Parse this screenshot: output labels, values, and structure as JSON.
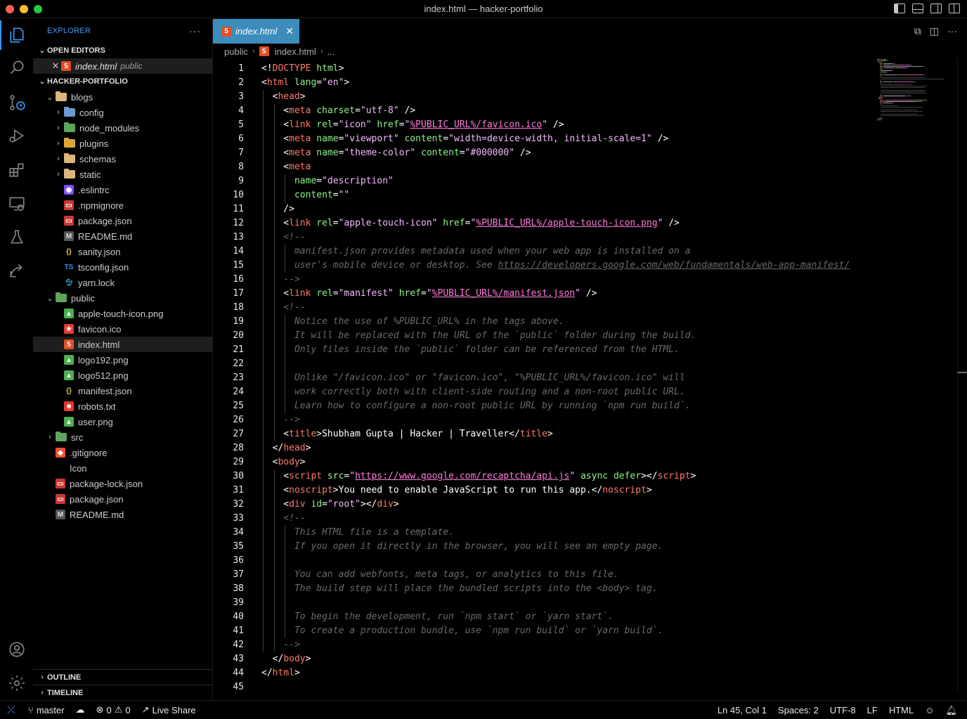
{
  "window": {
    "title": "index.html — hacker-portfolio"
  },
  "sidebar": {
    "title": "EXPLORER",
    "more": "···",
    "open_editors": {
      "label": "OPEN EDITORS",
      "items": [
        {
          "name": "index.html",
          "desc": "public"
        }
      ]
    },
    "project": {
      "label": "HACKER-PORTFOLIO",
      "tree": [
        {
          "name": "blogs",
          "kind": "folder-open",
          "depth": 1
        },
        {
          "name": "config",
          "kind": "folder",
          "depth": 2,
          "color": "blue"
        },
        {
          "name": "node_modules",
          "kind": "folder",
          "depth": 2,
          "color": "green"
        },
        {
          "name": "plugins",
          "kind": "folder",
          "depth": 2,
          "color": "orange"
        },
        {
          "name": "schemas",
          "kind": "folder",
          "depth": 2
        },
        {
          "name": "static",
          "kind": "folder",
          "depth": 2
        },
        {
          "name": ".eslintrc",
          "kind": "eslint",
          "depth": 2
        },
        {
          "name": ".npmignore",
          "kind": "npm",
          "depth": 2
        },
        {
          "name": "package.json",
          "kind": "npm",
          "depth": 2
        },
        {
          "name": "README.md",
          "kind": "md",
          "depth": 2
        },
        {
          "name": "sanity.json",
          "kind": "json",
          "depth": 2
        },
        {
          "name": "tsconfig.json",
          "kind": "ts",
          "depth": 2
        },
        {
          "name": "yarn.lock",
          "kind": "yarn",
          "depth": 2
        },
        {
          "name": "public",
          "kind": "folder-open-green",
          "depth": 1
        },
        {
          "name": "apple-touch-icon.png",
          "kind": "image",
          "depth": 2
        },
        {
          "name": "favicon.ico",
          "kind": "favicon",
          "depth": 2
        },
        {
          "name": "index.html",
          "kind": "html",
          "depth": 2,
          "selected": true
        },
        {
          "name": "logo192.png",
          "kind": "image",
          "depth": 2
        },
        {
          "name": "logo512.png",
          "kind": "image",
          "depth": 2
        },
        {
          "name": "manifest.json",
          "kind": "json",
          "depth": 2
        },
        {
          "name": "robots.txt",
          "kind": "robot",
          "depth": 2
        },
        {
          "name": "user.png",
          "kind": "image",
          "depth": 2
        },
        {
          "name": "src",
          "kind": "folder-green",
          "depth": 1
        },
        {
          "name": ".gitignore",
          "kind": "git",
          "depth": 1
        },
        {
          "name": "Icon",
          "kind": "file",
          "depth": 1
        },
        {
          "name": "package-lock.json",
          "kind": "npm",
          "depth": 1
        },
        {
          "name": "package.json",
          "kind": "npm",
          "depth": 1
        },
        {
          "name": "README.md",
          "kind": "md",
          "depth": 1
        }
      ]
    },
    "outline_label": "OUTLINE",
    "timeline_label": "TIMELINE"
  },
  "editor": {
    "tab_label": "index.html",
    "breadcrumb": [
      "public",
      "index.html",
      "..."
    ]
  },
  "code_lines": [
    [
      [
        "<!",
        "p"
      ],
      [
        "DOCTYPE",
        "tag"
      ],
      [
        " html",
        "attr"
      ],
      [
        ">",
        "p"
      ]
    ],
    [
      [
        "<",
        "p"
      ],
      [
        "html",
        "tag"
      ],
      [
        " lang",
        "attr"
      ],
      [
        "=",
        "p"
      ],
      [
        "\"en\"",
        "str"
      ],
      [
        ">",
        "p"
      ]
    ],
    [
      [
        "  <",
        "p"
      ],
      [
        "head",
        "tag"
      ],
      [
        ">",
        "p"
      ]
    ],
    [
      [
        "    <",
        "p"
      ],
      [
        "meta",
        "tag"
      ],
      [
        " charset",
        "attr"
      ],
      [
        "=",
        "p"
      ],
      [
        "\"utf-8\"",
        "str"
      ],
      [
        " />",
        "p"
      ]
    ],
    [
      [
        "    <",
        "p"
      ],
      [
        "link",
        "tag"
      ],
      [
        " rel",
        "attr"
      ],
      [
        "=",
        "p"
      ],
      [
        "\"icon\"",
        "str"
      ],
      [
        " href",
        "attr"
      ],
      [
        "=",
        "p"
      ],
      [
        "\"",
        "str"
      ],
      [
        "%PUBLIC_URL%/favicon.ico",
        "link"
      ],
      [
        "\"",
        "str"
      ],
      [
        " />",
        "p"
      ]
    ],
    [
      [
        "    <",
        "p"
      ],
      [
        "meta",
        "tag"
      ],
      [
        " name",
        "attr"
      ],
      [
        "=",
        "p"
      ],
      [
        "\"viewport\"",
        "str"
      ],
      [
        " content",
        "attr"
      ],
      [
        "=",
        "p"
      ],
      [
        "\"width=device-width, initial-scale=1\"",
        "str"
      ],
      [
        " />",
        "p"
      ]
    ],
    [
      [
        "    <",
        "p"
      ],
      [
        "meta",
        "tag"
      ],
      [
        " name",
        "attr"
      ],
      [
        "=",
        "p"
      ],
      [
        "\"theme-color\"",
        "str"
      ],
      [
        " content",
        "attr"
      ],
      [
        "=",
        "p"
      ],
      [
        "\"#000000\"",
        "str"
      ],
      [
        " />",
        "p"
      ]
    ],
    [
      [
        "    <",
        "p"
      ],
      [
        "meta",
        "tag"
      ]
    ],
    [
      [
        "      name",
        "attr"
      ],
      [
        "=",
        "p"
      ],
      [
        "\"description\"",
        "str"
      ]
    ],
    [
      [
        "      content",
        "attr"
      ],
      [
        "=",
        "p"
      ],
      [
        "\"\"",
        "str"
      ]
    ],
    [
      [
        "    />",
        "p"
      ]
    ],
    [
      [
        "    <",
        "p"
      ],
      [
        "link",
        "tag"
      ],
      [
        " rel",
        "attr"
      ],
      [
        "=",
        "p"
      ],
      [
        "\"apple-touch-icon\"",
        "str"
      ],
      [
        " href",
        "attr"
      ],
      [
        "=",
        "p"
      ],
      [
        "\"",
        "str"
      ],
      [
        "%PUBLIC_URL%/apple-touch-icon.png",
        "link"
      ],
      [
        "\"",
        "str"
      ],
      [
        " />",
        "p"
      ]
    ],
    [
      [
        "    <!--",
        "com"
      ]
    ],
    [
      [
        "      manifest.json provides metadata used when your web app is installed on a",
        "com"
      ]
    ],
    [
      [
        "      user's mobile device or desktop. See ",
        "com"
      ],
      [
        "https://developers.google.com/web/fundamentals/web-app-manifest/",
        "comlink"
      ]
    ],
    [
      [
        "    -->",
        "com"
      ]
    ],
    [
      [
        "    <",
        "p"
      ],
      [
        "link",
        "tag"
      ],
      [
        " rel",
        "attr"
      ],
      [
        "=",
        "p"
      ],
      [
        "\"manifest\"",
        "str"
      ],
      [
        " href",
        "attr"
      ],
      [
        "=",
        "p"
      ],
      [
        "\"",
        "str"
      ],
      [
        "%PUBLIC_URL%/manifest.json",
        "link"
      ],
      [
        "\"",
        "str"
      ],
      [
        " />",
        "p"
      ]
    ],
    [
      [
        "    <!--",
        "com"
      ]
    ],
    [
      [
        "      Notice the use of %PUBLIC_URL% in the tags above.",
        "com"
      ]
    ],
    [
      [
        "      It will be replaced with the URL of the `public` folder during the build.",
        "com"
      ]
    ],
    [
      [
        "      Only files inside the `public` folder can be referenced from the HTML.",
        "com"
      ]
    ],
    [],
    [
      [
        "      Unlike \"/favicon.ico\" or \"favicon.ico\", \"%PUBLIC_URL%/favicon.ico\" will",
        "com"
      ]
    ],
    [
      [
        "      work correctly both with client-side routing and a non-root public URL.",
        "com"
      ]
    ],
    [
      [
        "      Learn how to configure a non-root public URL by running `npm run build`.",
        "com"
      ]
    ],
    [
      [
        "    -->",
        "com"
      ]
    ],
    [
      [
        "    <",
        "p"
      ],
      [
        "title",
        "tag"
      ],
      [
        ">",
        "p"
      ],
      [
        "Shubham Gupta | Hacker | Traveller",
        "txt"
      ],
      [
        "</",
        "p"
      ],
      [
        "title",
        "tag"
      ],
      [
        ">",
        "p"
      ]
    ],
    [
      [
        "  </",
        "p"
      ],
      [
        "head",
        "tag"
      ],
      [
        ">",
        "p"
      ]
    ],
    [
      [
        "  <",
        "p"
      ],
      [
        "body",
        "tag"
      ],
      [
        ">",
        "p"
      ]
    ],
    [
      [
        "    <",
        "p"
      ],
      [
        "script",
        "tag"
      ],
      [
        " src",
        "attr"
      ],
      [
        "=",
        "p"
      ],
      [
        "\"",
        "str"
      ],
      [
        "https://www.google.com/recaptcha/api.js",
        "link"
      ],
      [
        "\"",
        "str"
      ],
      [
        " async defer",
        "attr"
      ],
      [
        "></",
        "p"
      ],
      [
        "script",
        "tag"
      ],
      [
        ">",
        "p"
      ]
    ],
    [
      [
        "    <",
        "p"
      ],
      [
        "noscript",
        "tag"
      ],
      [
        ">",
        "p"
      ],
      [
        "You need to enable JavaScript to run this app.",
        "txt"
      ],
      [
        "</",
        "p"
      ],
      [
        "noscript",
        "tag"
      ],
      [
        ">",
        "p"
      ]
    ],
    [
      [
        "    <",
        "p"
      ],
      [
        "div",
        "tag"
      ],
      [
        " id",
        "attr"
      ],
      [
        "=",
        "p"
      ],
      [
        "\"root\"",
        "str"
      ],
      [
        "></",
        "p"
      ],
      [
        "div",
        "tag"
      ],
      [
        ">",
        "p"
      ]
    ],
    [
      [
        "    <!--",
        "com"
      ]
    ],
    [
      [
        "      This HTML file is a template.",
        "com"
      ]
    ],
    [
      [
        "      If you open it directly in the browser, you will see an empty page.",
        "com"
      ]
    ],
    [],
    [
      [
        "      You can add webfonts, meta tags, or analytics to this file.",
        "com"
      ]
    ],
    [
      [
        "      The build step will place the bundled scripts into the <body> tag.",
        "com"
      ]
    ],
    [],
    [
      [
        "      To begin the development, run `npm start` or `yarn start`.",
        "com"
      ]
    ],
    [
      [
        "      To create a production bundle, use `npm run build` or `yarn build`.",
        "com"
      ]
    ],
    [
      [
        "    -->",
        "com"
      ]
    ],
    [
      [
        "  </",
        "p"
      ],
      [
        "body",
        "tag"
      ],
      [
        ">",
        "p"
      ]
    ],
    [
      [
        "</",
        "p"
      ],
      [
        "html",
        "tag"
      ],
      [
        ">",
        "p"
      ]
    ],
    []
  ],
  "statusbar": {
    "branch": "master",
    "errors": "0",
    "warnings": "0",
    "live_share": "Live Share",
    "position": "Ln 45, Col 1",
    "spaces": "Spaces: 2",
    "encoding": "UTF-8",
    "eol": "LF",
    "language": "HTML"
  },
  "colors": {
    "accent": "#3794ff",
    "tab_active": "#3c8dbc",
    "tag": "#ff7a6b",
    "attr": "#8cf58a",
    "string": "#f5b9ff",
    "comment": "#6a6a6a"
  }
}
